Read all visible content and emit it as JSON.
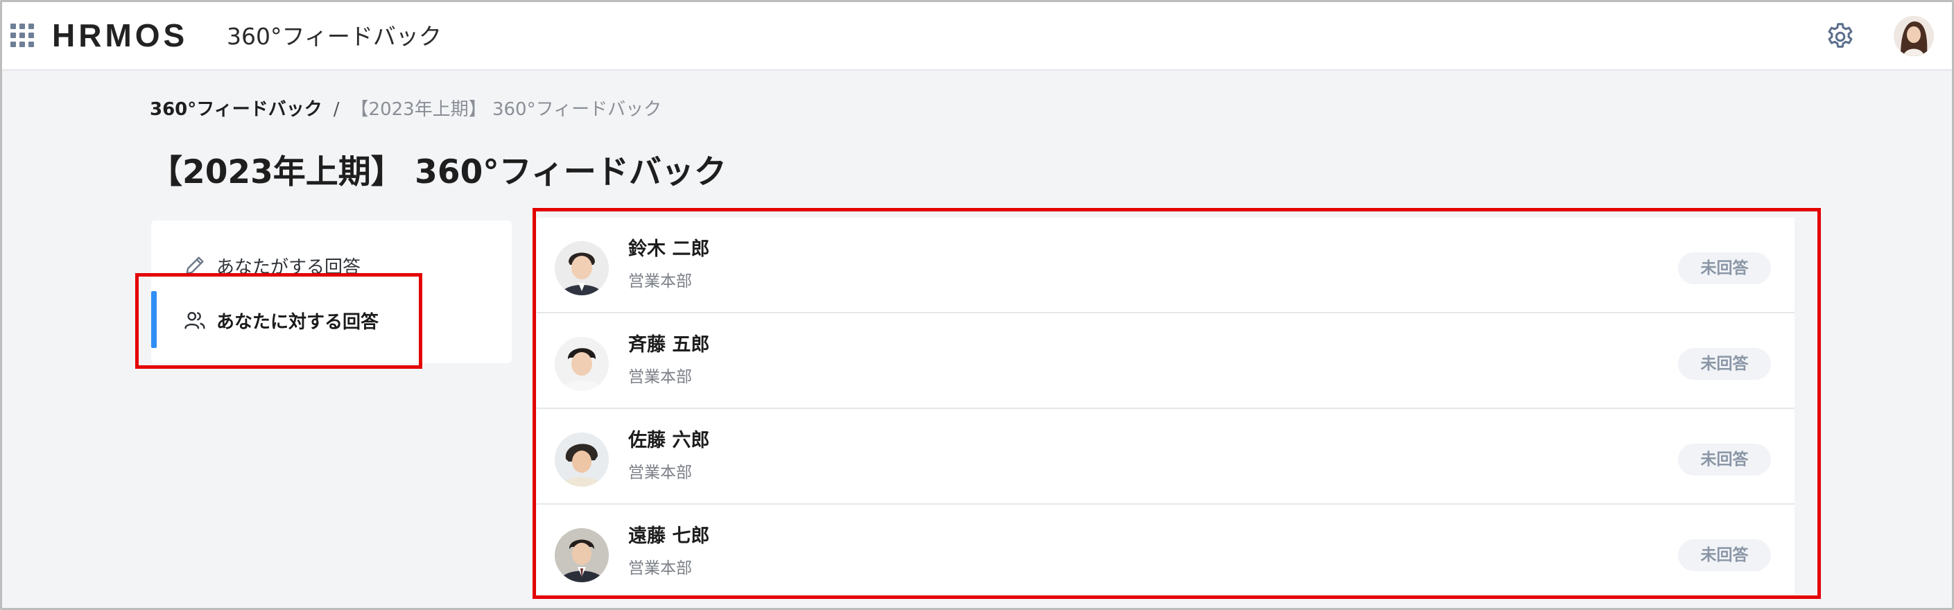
{
  "header": {
    "logo": "HRMOS",
    "app_name": "360°フィードバック",
    "icons": [
      "apps-grid-icon",
      "gear-icon",
      "user-avatar"
    ]
  },
  "breadcrumb": {
    "root": "360°フィードバック",
    "separator": "/",
    "current": "【2023年上期】 360°フィードバック"
  },
  "page_title": "【2023年上期】 360°フィードバック",
  "side_menu": {
    "items": [
      {
        "label": "あなたがする回答",
        "icon": "pencil-icon",
        "active": false
      },
      {
        "label": "あなたに対する回答",
        "icon": "users-icon",
        "active": true
      }
    ]
  },
  "list": {
    "rows": [
      {
        "name": "鈴木 二郎",
        "dept": "営業本部",
        "status": "未回答"
      },
      {
        "name": "斉藤 五郎",
        "dept": "営業本部",
        "status": "未回答"
      },
      {
        "name": "佐藤 六郎",
        "dept": "営業本部",
        "status": "未回答"
      },
      {
        "name": "遠藤 七郎",
        "dept": "営業本部",
        "status": "未回答"
      }
    ]
  },
  "colors": {
    "accent": "#2f8ef4",
    "highlight": "#e30000",
    "status_badge_bg": "#f1f3f6",
    "page_bg": "#f3f4f6"
  }
}
